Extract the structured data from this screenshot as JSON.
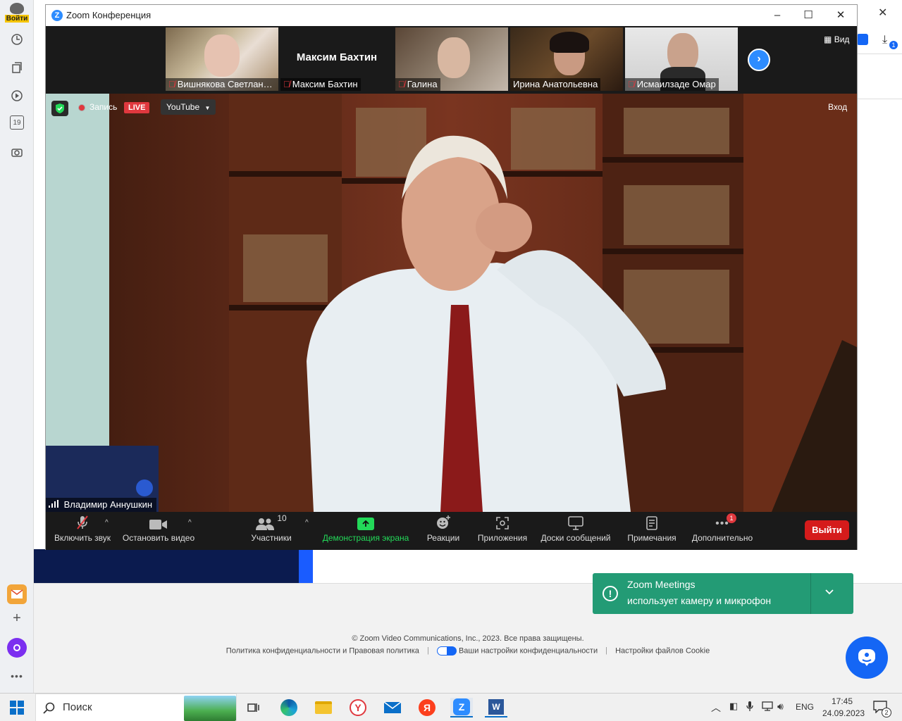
{
  "browser": {
    "login_label": "Войти",
    "calendar_day": "19",
    "close_glyph": "✕",
    "footer_copyright": "© Zoom Video Communications, Inc., 2023. Все права защищены.",
    "footer_privacy": "Политика конфиденциальности и Правовая политика",
    "footer_choices": "Ваши настройки конфиденциальности",
    "footer_cookies": "Настройки файлов Cookie",
    "toast_title": "Zoom Meetings",
    "toast_text": "использует камеру и микрофон",
    "ext_badge": "1"
  },
  "zoom": {
    "window_title": "Zoom Конференция",
    "view_label": "Вид",
    "record_label": "Запись",
    "live_label": "LIVE",
    "youtube_label": "YouTube",
    "login_label": "Вход",
    "speaker_name": "Владимир Аннушкин",
    "participants": [
      {
        "name": "Вишнякова Светлана..."
      },
      {
        "name": "Максим Бахтин",
        "display_name": "Максим Бахтин"
      },
      {
        "name": "Галина"
      },
      {
        "name": "Ирина  Анатольевна"
      },
      {
        "name": "Исмаилзаде Омар"
      }
    ],
    "toolbar": {
      "unmute": "Включить звук",
      "stop_video": "Остановить видео",
      "participants": "Участники",
      "participants_count": "10",
      "share": "Демонстрация экрана",
      "reactions": "Реакции",
      "apps": "Приложения",
      "whiteboards": "Доски сообщений",
      "notes": "Примечания",
      "more": "Дополнительно",
      "more_badge": "1",
      "leave": "Выйти"
    },
    "colors": {
      "accent": "#2d8cff",
      "share": "#23d959",
      "leave": "#d51b1b",
      "live": "#e0383e"
    }
  },
  "taskbar": {
    "search_label": "Поиск",
    "language": "ENG",
    "time": "17:45",
    "date": "24.09.2023",
    "notifications": "2"
  }
}
